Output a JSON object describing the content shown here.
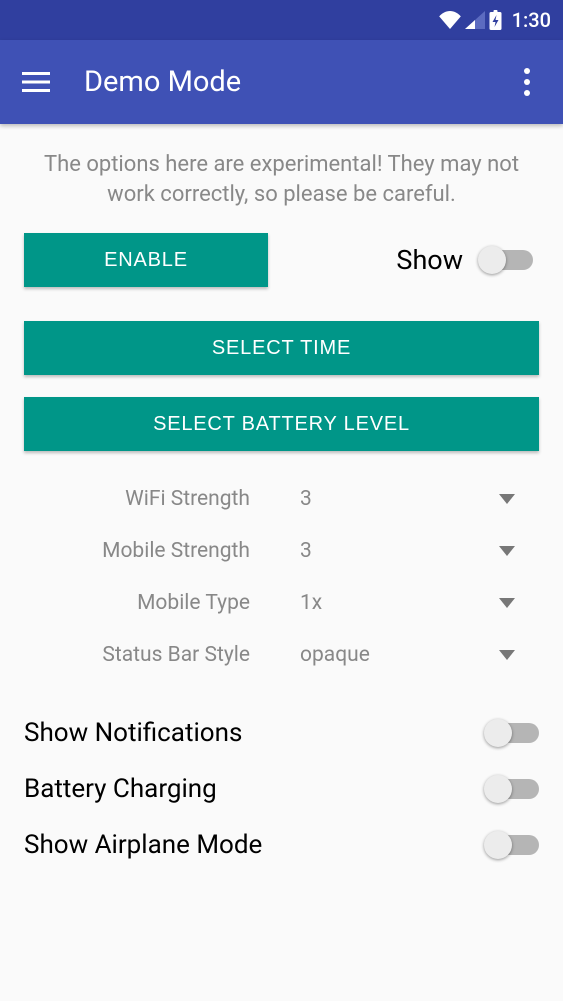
{
  "status_bar": {
    "time": "1:30"
  },
  "app_bar": {
    "title": "Demo Mode"
  },
  "warning": "The options here are experimental! They may not work correctly, so please be careful.",
  "buttons": {
    "enable": "Enable",
    "show_label": "Show",
    "select_time": "Select Time",
    "select_battery": "Select Battery Level"
  },
  "dropdowns": [
    {
      "label": "WiFi Strength",
      "value": "3"
    },
    {
      "label": "Mobile Strength",
      "value": "3"
    },
    {
      "label": "Mobile Type",
      "value": "1x"
    },
    {
      "label": "Status Bar Style",
      "value": "opaque"
    }
  ],
  "toggles": [
    {
      "label": "Show Notifications",
      "on": false
    },
    {
      "label": "Battery Charging",
      "on": false
    },
    {
      "label": "Show Airplane Mode",
      "on": false
    }
  ]
}
